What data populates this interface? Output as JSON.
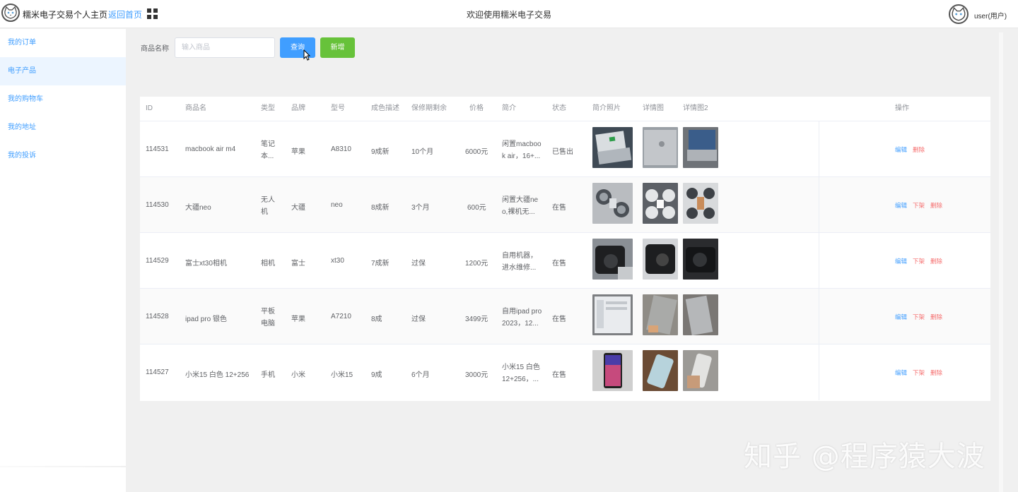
{
  "header": {
    "site_title": "糯米电子交易个人主页",
    "home_link": "返回首页",
    "welcome": "欢迎使用糯米电子交易",
    "user_name": "user(用户)"
  },
  "sidebar": {
    "items": [
      {
        "label": "我的订单"
      },
      {
        "label": "电子产品",
        "active": true
      },
      {
        "label": "我的购物车"
      },
      {
        "label": "我的地址"
      },
      {
        "label": "我的投诉"
      }
    ]
  },
  "search": {
    "label": "商品名称",
    "placeholder": "输入商品",
    "query_button": "查询",
    "add_button": "新增"
  },
  "table": {
    "headers": {
      "id": "ID",
      "name": "商品名",
      "type": "类型",
      "brand": "品牌",
      "model": "型号",
      "condition": "成色描述",
      "warranty": "保修期剩余",
      "price": "价格",
      "intro": "简介",
      "status": "状态",
      "intro_photo": "简介照片",
      "detail": "详情图",
      "detail2": "详情图2",
      "ops": "操作"
    },
    "rows": [
      {
        "id": "114531",
        "name": "macbook air m4",
        "type": [
          "笔记",
          "本..."
        ],
        "brand": "苹果",
        "model": "A8310",
        "condition": "9成新",
        "warranty": "10个月",
        "price": "6000元",
        "intro": [
          "闲置macboo",
          "k air，16+..."
        ],
        "status": "已售出",
        "ops": {
          "edit": "编辑",
          "delete": "删除"
        }
      },
      {
        "id": "114530",
        "name": "大疆neo",
        "type": [
          "无人",
          "机"
        ],
        "brand": "大疆",
        "model": "neo",
        "condition": "8成新",
        "warranty": "3个月",
        "price": "600元",
        "intro": [
          "闲置大疆ne",
          "o,裸机无..."
        ],
        "status": "在售",
        "ops": {
          "edit": "编辑",
          "off": "下架",
          "delete": "删除"
        }
      },
      {
        "id": "114529",
        "name": "富士xt30相机",
        "type": [
          "相机"
        ],
        "brand": "富士",
        "model": "xt30",
        "condition": "7成新",
        "warranty": "过保",
        "price": "1200元",
        "intro": [
          "自用机器，",
          "进水维修..."
        ],
        "status": "在售",
        "ops": {
          "edit": "编辑",
          "off": "下架",
          "delete": "删除"
        }
      },
      {
        "id": "114528",
        "name": "ipad pro 银色",
        "type": [
          "平板",
          "电脑"
        ],
        "brand": "苹果",
        "model": "A7210",
        "condition": "8成",
        "warranty": "过保",
        "price": "3499元",
        "intro": [
          "自用ipad pro",
          "2023，12..."
        ],
        "status": "在售",
        "ops": {
          "edit": "编辑",
          "off": "下架",
          "delete": "删除"
        }
      },
      {
        "id": "114527",
        "name": "小米15 白色 12+256",
        "type": [
          "手机"
        ],
        "brand": "小米",
        "model": "小米15",
        "condition": "9成",
        "warranty": "6个月",
        "price": "3000元",
        "intro": [
          "小米15 白色",
          "12+256，..."
        ],
        "status": "在售",
        "ops": {
          "edit": "编辑",
          "off": "下架",
          "delete": "删除"
        }
      }
    ]
  },
  "watermark": "知乎 @程序猿大波",
  "colors": {
    "primary": "#409eff",
    "success": "#67c23a",
    "danger": "#f56c6c"
  },
  "icons": [
    "logo-cat-icon",
    "grid-menu-icon",
    "user-avatar-icon",
    "mouse-cursor-icon"
  ]
}
